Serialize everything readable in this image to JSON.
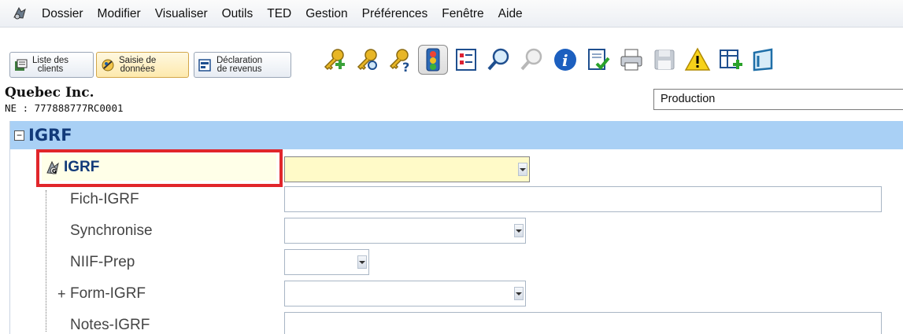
{
  "menu": [
    "Dossier",
    "Modifier",
    "Visualiser",
    "Outils",
    "TED",
    "Gestion",
    "Préférences",
    "Fenêtre",
    "Aide"
  ],
  "nav_tabs": [
    {
      "label": "Liste des clients",
      "line1": "Liste des",
      "line2": "clients"
    },
    {
      "label": "Saisie de données",
      "line1": "Saisie de",
      "line2": "données"
    },
    {
      "label": "Déclaration de revenus",
      "line1": "Déclaration",
      "line2": "de revenus"
    }
  ],
  "toolbar_icons": [
    "key-add-icon",
    "key-search-icon",
    "key-help-icon",
    "traffic-light-icon",
    "checklist-icon",
    "zoom-in-icon",
    "zoom-out-icon",
    "info-icon",
    "document-check-icon",
    "print-icon",
    "save-icon",
    "warning-icon",
    "table-add-icon",
    "book-icon"
  ],
  "company": {
    "name": "Quebec Inc.",
    "ne": "NE : 777888777RC0001"
  },
  "profile_select": {
    "value": "Production"
  },
  "tree": {
    "group_title": "IGRF",
    "rows": [
      {
        "label": "IGRF",
        "selected": true
      },
      {
        "label": "Fich-IGRF"
      },
      {
        "label": "Synchronise"
      },
      {
        "label": "NIIF-Prep"
      },
      {
        "label": "Form-IGRF",
        "prefix": "+"
      },
      {
        "label": "Notes-IGRF"
      }
    ]
  },
  "colors": {
    "header_bg": "#a9d0f5",
    "highlight": "#e1262b",
    "field_yellow": "#fffac8",
    "title": "#123a79"
  }
}
